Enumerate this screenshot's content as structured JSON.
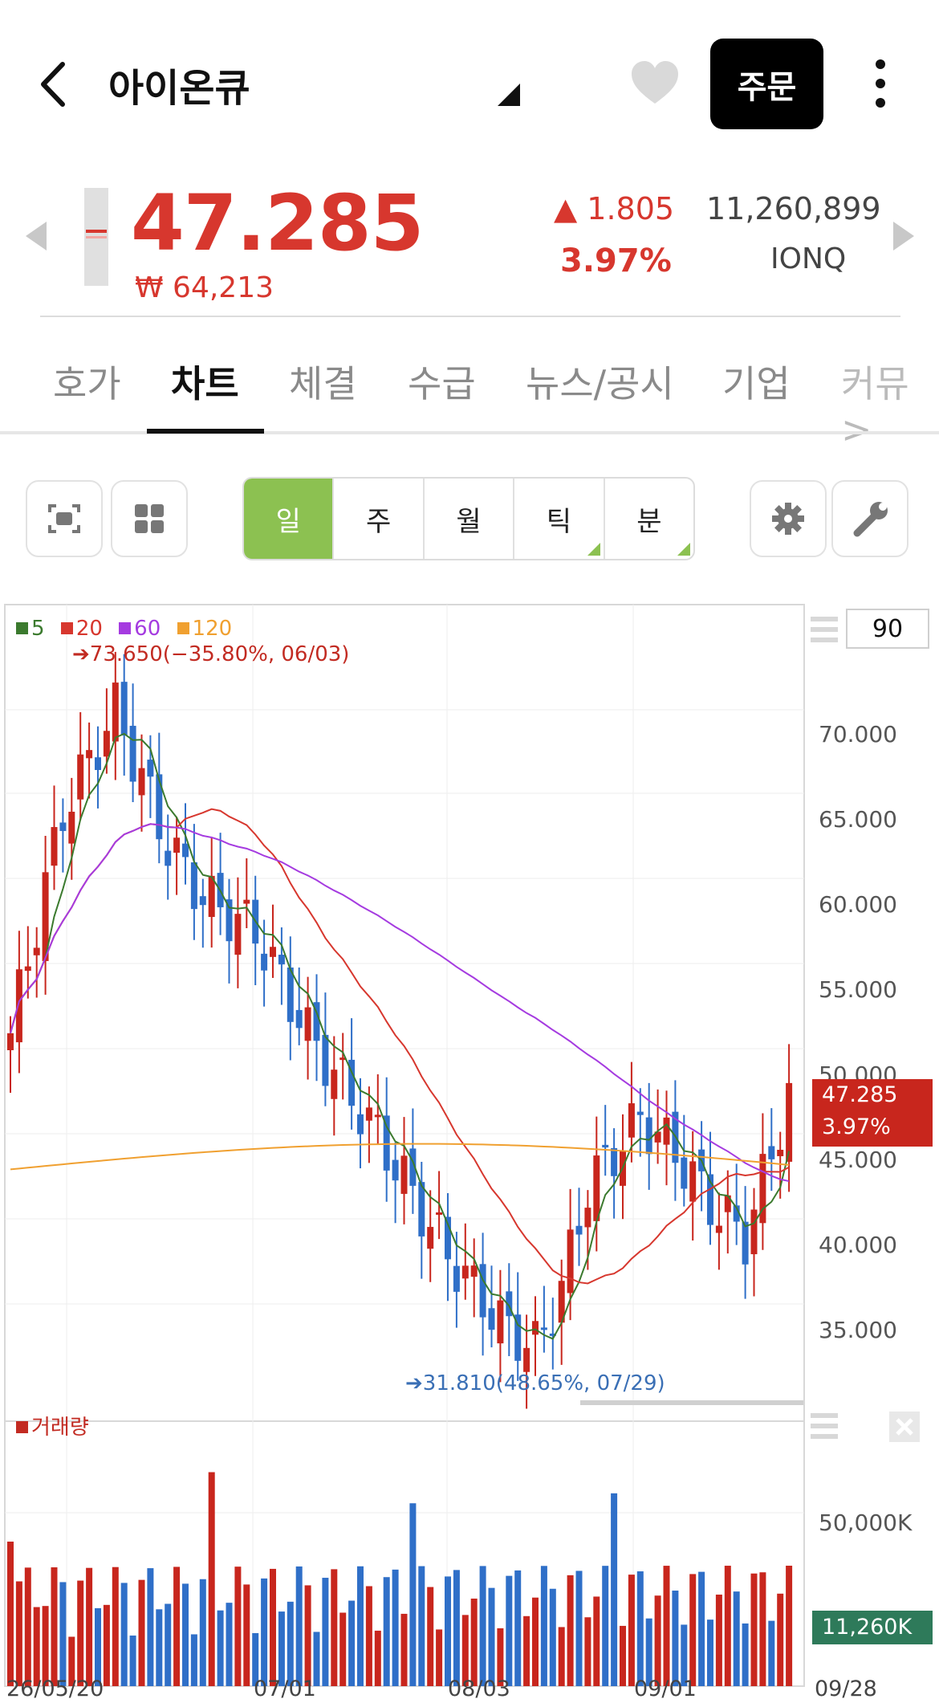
{
  "header": {
    "title": "아이온큐",
    "order_button": "주문"
  },
  "quote": {
    "price": "47.285",
    "price_krw": "₩ 64,213",
    "change": "▲ 1.805",
    "change_pct": "3.97%",
    "volume": "11,260,899",
    "ticker": "IONQ"
  },
  "tabs": [
    "호가",
    "차트",
    "체결",
    "수급",
    "뉴스/공시",
    "기업",
    "커뮤>"
  ],
  "active_tab": "차트",
  "periods": [
    "일",
    "주",
    "월",
    "틱",
    "분"
  ],
  "active_period": "일",
  "chart": {
    "ma_legend": [
      {
        "label": "5",
        "color": "#3b7a2e"
      },
      {
        "label": "20",
        "color": "#d7372e"
      },
      {
        "label": "60",
        "color": "#a53be0"
      },
      {
        "label": "120",
        "color": "#f0a030"
      }
    ],
    "max_note": "➔73.650(−35.80%, 06/03)",
    "min_note": "➔31.810(48.65%, 07/29)",
    "period_count": "90",
    "current_price_label": "47.285",
    "current_pct_label": "3.97%",
    "volume_legend": "거래량",
    "volume_current_label": "11,260K"
  },
  "chart_data": {
    "type": "candlestick",
    "x_labels": [
      "26/05/20",
      "07/01",
      "08/03",
      "09/01",
      "09/28"
    ],
    "y_tick_labels": [
      "70.000",
      "65.000",
      "60.000",
      "55.000",
      "50.000",
      "45.000",
      "40.000",
      "35.000"
    ],
    "ylim": [
      31.8,
      73.65
    ],
    "volume_tick_labels": [
      "50,000K"
    ],
    "series": [
      {
        "name": "5",
        "color": "#3b7a2e"
      },
      {
        "name": "20",
        "color": "#d7372e"
      },
      {
        "name": "60",
        "color": "#a53be0"
      },
      {
        "name": "120",
        "color": "#f0a030"
      }
    ],
    "max": {
      "value": 73.65,
      "date": "06/03"
    },
    "min": {
      "value": 31.81,
      "date": "07/29"
    },
    "last_close": 47.285,
    "last_volume_k": 11260
  }
}
